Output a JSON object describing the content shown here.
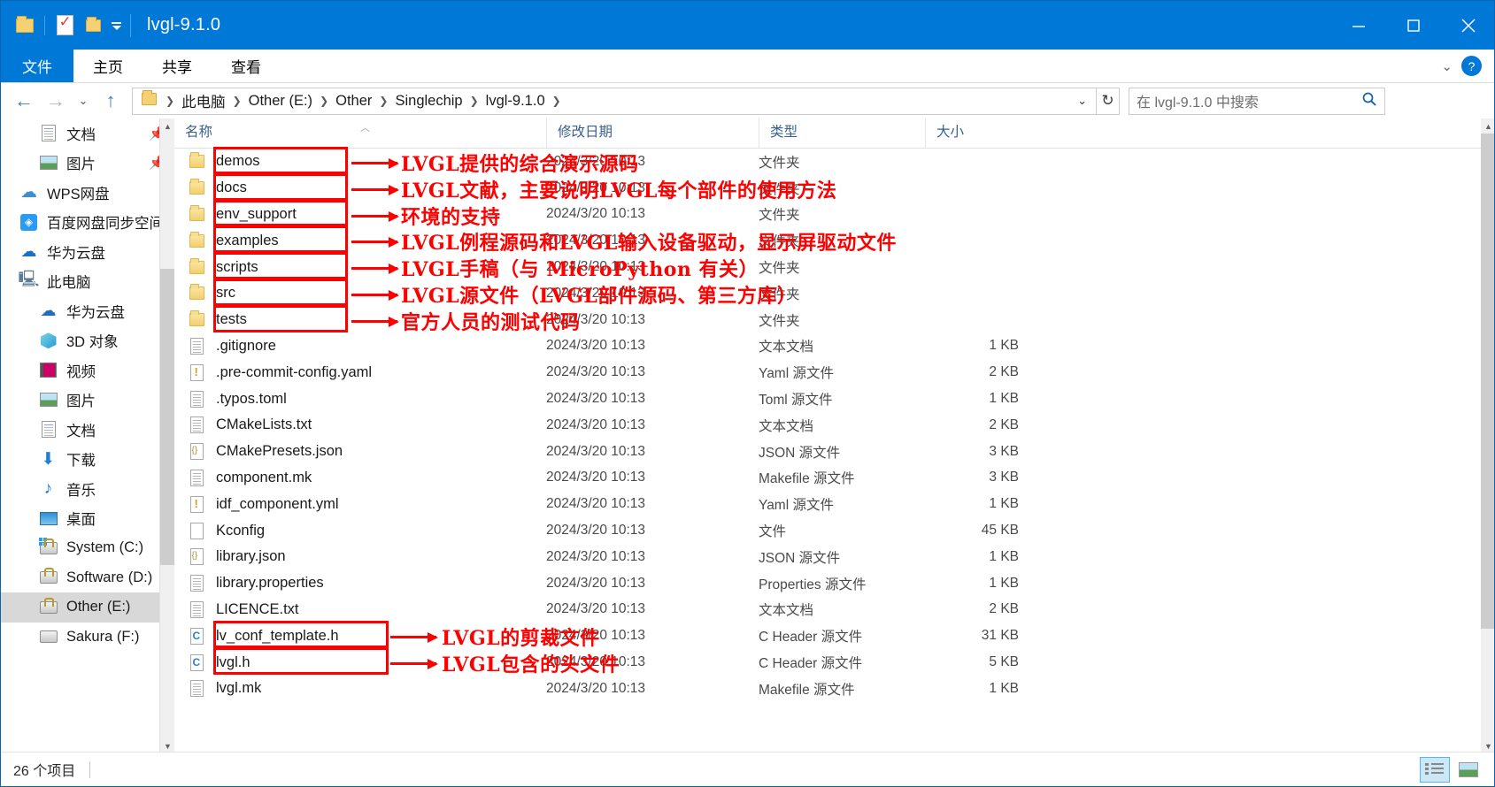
{
  "window": {
    "title": "lvgl-9.1.0",
    "quick_access_icons": [
      "folder-icon",
      "properties-icon",
      "new-folder-icon"
    ],
    "controls": {
      "minimize": "minimize-icon",
      "maximize": "maximize-icon",
      "close": "close-icon"
    }
  },
  "ribbon": {
    "tabs": [
      {
        "label": "文件",
        "active": true
      },
      {
        "label": "主页",
        "active": false
      },
      {
        "label": "共享",
        "active": false
      },
      {
        "label": "查看",
        "active": false
      }
    ],
    "collapse_icon": "chevron-down-icon",
    "help_icon": "help-icon"
  },
  "address": {
    "back_icon": "arrow-left-icon",
    "forward_icon": "arrow-right-icon",
    "recent_icon": "chevron-down-icon",
    "up_icon": "arrow-up-icon",
    "breadcrumbs": [
      "此电脑",
      "Other (E:)",
      "Other",
      "Singlechip",
      "lvgl-9.1.0"
    ],
    "dropdown_icon": "chevron-down-icon",
    "refresh_icon": "refresh-icon",
    "search_placeholder": "在 lvgl-9.1.0 中搜索",
    "search_value": "",
    "search_icon": "search-icon"
  },
  "sidebar": {
    "items": [
      {
        "label": "文档",
        "icon": "document-icon",
        "indent": 1,
        "pinned": true,
        "selected": false
      },
      {
        "label": "图片",
        "icon": "pictures-icon",
        "indent": 1,
        "pinned": true,
        "selected": false
      },
      {
        "label": "WPS网盘",
        "icon": "cloud-icon",
        "indent": 0,
        "pinned": false,
        "selected": false
      },
      {
        "label": "百度网盘同步空间",
        "icon": "baidu-netdisk-icon",
        "indent": 0,
        "pinned": false,
        "selected": false
      },
      {
        "label": "华为云盘",
        "icon": "huawei-cloud-icon",
        "indent": 0,
        "pinned": false,
        "selected": false
      },
      {
        "label": "此电脑",
        "icon": "this-pc-icon",
        "indent": 0,
        "pinned": false,
        "selected": false
      },
      {
        "label": "华为云盘",
        "icon": "huawei-cloud-icon",
        "indent": 1,
        "pinned": false,
        "selected": false
      },
      {
        "label": "3D 对象",
        "icon": "3d-objects-icon",
        "indent": 1,
        "pinned": false,
        "selected": false
      },
      {
        "label": "视频",
        "icon": "videos-icon",
        "indent": 1,
        "pinned": false,
        "selected": false
      },
      {
        "label": "图片",
        "icon": "pictures-icon",
        "indent": 1,
        "pinned": false,
        "selected": false
      },
      {
        "label": "文档",
        "icon": "document-icon",
        "indent": 1,
        "pinned": false,
        "selected": false
      },
      {
        "label": "下载",
        "icon": "downloads-icon",
        "indent": 1,
        "pinned": false,
        "selected": false
      },
      {
        "label": "音乐",
        "icon": "music-icon",
        "indent": 1,
        "pinned": false,
        "selected": false
      },
      {
        "label": "桌面",
        "icon": "desktop-icon",
        "indent": 1,
        "pinned": false,
        "selected": false
      },
      {
        "label": "System (C:)",
        "icon": "system-drive-icon",
        "indent": 1,
        "pinned": false,
        "selected": false
      },
      {
        "label": "Software (D:)",
        "icon": "drive-icon",
        "indent": 1,
        "pinned": false,
        "selected": false
      },
      {
        "label": "Other (E:)",
        "icon": "drive-icon",
        "indent": 1,
        "pinned": false,
        "selected": true
      },
      {
        "label": "Sakura (F:)",
        "icon": "drive-plain-icon",
        "indent": 1,
        "pinned": false,
        "selected": false
      }
    ]
  },
  "columns": [
    {
      "label": "名称",
      "sorted": true
    },
    {
      "label": "修改日期",
      "sorted": false
    },
    {
      "label": "类型",
      "sorted": false
    },
    {
      "label": "大小",
      "sorted": false
    }
  ],
  "files": [
    {
      "name": "demos",
      "date": "2024/3/20 10:13",
      "type": "文件夹",
      "size": "",
      "icon": "folder-icon"
    },
    {
      "name": "docs",
      "date": "2024/3/20 10:13",
      "type": "文件夹",
      "size": "",
      "icon": "folder-icon"
    },
    {
      "name": "env_support",
      "date": "2024/3/20 10:13",
      "type": "文件夹",
      "size": "",
      "icon": "folder-icon"
    },
    {
      "name": "examples",
      "date": "2024/3/20 10:13",
      "type": "文件夹",
      "size": "",
      "icon": "folder-icon"
    },
    {
      "name": "scripts",
      "date": "2024/3/20 10:13",
      "type": "文件夹",
      "size": "",
      "icon": "folder-icon"
    },
    {
      "name": "src",
      "date": "2024/3/20 10:13",
      "type": "文件夹",
      "size": "",
      "icon": "folder-icon"
    },
    {
      "name": "tests",
      "date": "2024/3/20 10:13",
      "type": "文件夹",
      "size": "",
      "icon": "folder-icon"
    },
    {
      "name": ".gitignore",
      "date": "2024/3/20 10:13",
      "type": "文本文档",
      "size": "1 KB",
      "icon": "text-file-icon"
    },
    {
      "name": ".pre-commit-config.yaml",
      "date": "2024/3/20 10:13",
      "type": "Yaml 源文件",
      "size": "2 KB",
      "icon": "yaml-file-icon"
    },
    {
      "name": ".typos.toml",
      "date": "2024/3/20 10:13",
      "type": "Toml 源文件",
      "size": "1 KB",
      "icon": "toml-file-icon"
    },
    {
      "name": "CMakeLists.txt",
      "date": "2024/3/20 10:13",
      "type": "文本文档",
      "size": "2 KB",
      "icon": "text-file-icon"
    },
    {
      "name": "CMakePresets.json",
      "date": "2024/3/20 10:13",
      "type": "JSON 源文件",
      "size": "3 KB",
      "icon": "json-file-icon"
    },
    {
      "name": "component.mk",
      "date": "2024/3/20 10:13",
      "type": "Makefile 源文件",
      "size": "3 KB",
      "icon": "makefile-icon"
    },
    {
      "name": "idf_component.yml",
      "date": "2024/3/20 10:13",
      "type": "Yaml 源文件",
      "size": "1 KB",
      "icon": "yaml-file-icon"
    },
    {
      "name": "Kconfig",
      "date": "2024/3/20 10:13",
      "type": "文件",
      "size": "45 KB",
      "icon": "generic-file-icon"
    },
    {
      "name": "library.json",
      "date": "2024/3/20 10:13",
      "type": "JSON 源文件",
      "size": "1 KB",
      "icon": "json-file-icon"
    },
    {
      "name": "library.properties",
      "date": "2024/3/20 10:13",
      "type": "Properties 源文件",
      "size": "1 KB",
      "icon": "properties-file-icon"
    },
    {
      "name": "LICENCE.txt",
      "date": "2024/3/20 10:13",
      "type": "文本文档",
      "size": "2 KB",
      "icon": "text-file-icon"
    },
    {
      "name": "lv_conf_template.h",
      "date": "2024/3/20 10:13",
      "type": "C Header 源文件",
      "size": "31 KB",
      "icon": "c-header-icon"
    },
    {
      "name": "lvgl.h",
      "date": "2024/3/20 10:13",
      "type": "C Header 源文件",
      "size": "5 KB",
      "icon": "c-header-icon"
    },
    {
      "name": "lvgl.mk",
      "date": "2024/3/20 10:13",
      "type": "Makefile 源文件",
      "size": "1 KB",
      "icon": "makefile-icon"
    }
  ],
  "annotations": {
    "color": "#ff0000",
    "notes": [
      {
        "target": "demos",
        "text": "LVGL提供的综合演示源码"
      },
      {
        "target": "docs",
        "text": "LVGL文献，主要说明LVGL每个部件的使用方法"
      },
      {
        "target": "env_support",
        "text": "环境的支持"
      },
      {
        "target": "examples",
        "text": "LVGL例程源码和LVGL输入设备驱动，显示屏驱动文件"
      },
      {
        "target": "scripts",
        "text": "LVGL手稿（与 MicroPython 有关）"
      },
      {
        "target": "src",
        "text": "LVGL源文件（LVGL部件源码、第三方库）"
      },
      {
        "target": "tests",
        "text": "官方人员的测试代码"
      },
      {
        "target": "lv_conf_template.h",
        "text": "LVGL的剪裁文件"
      },
      {
        "target": "lvgl.h",
        "text": "LVGL包含的头文件"
      }
    ]
  },
  "statusbar": {
    "item_count": "26 个项目",
    "view_details_icon": "details-view-icon",
    "view_thumbnails_icon": "thumbnail-view-icon"
  }
}
